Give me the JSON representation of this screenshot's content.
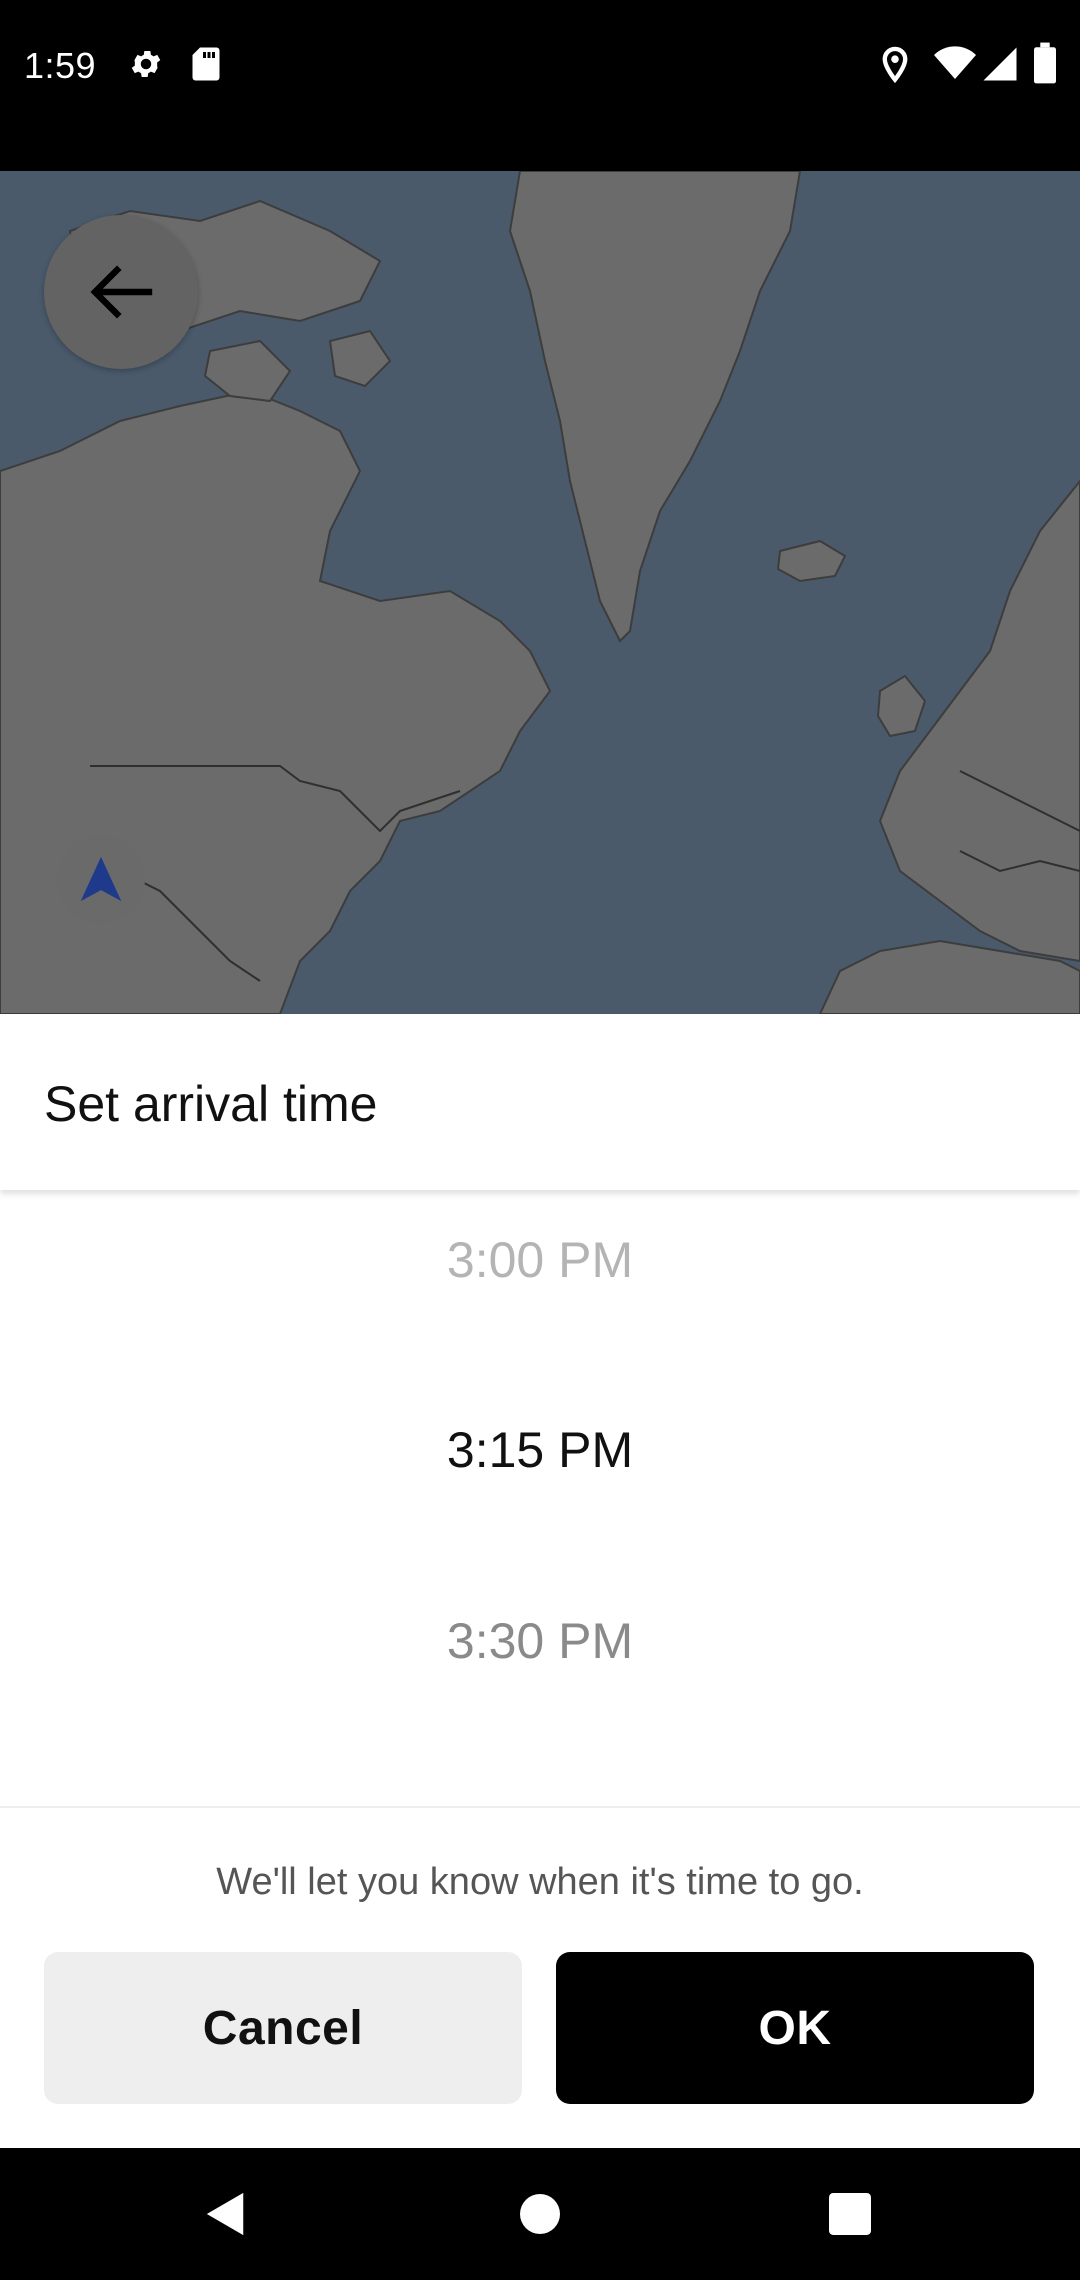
{
  "status_bar": {
    "time": "1:59",
    "icons": [
      "gear-icon",
      "sd-card-icon",
      "location-icon",
      "wifi-icon",
      "cellular-signal-icon",
      "battery-icon"
    ]
  },
  "map": {
    "back_icon": "arrow-left-icon",
    "location_icon": "navigation-arrow-icon"
  },
  "sheet": {
    "title": "Set arrival time"
  },
  "picker": {
    "items": [
      "3:00 PM",
      "3:15 PM",
      "3:30 PM"
    ],
    "selected": "3:15 PM"
  },
  "footer": {
    "note": "We'll let you know when it's time to go.",
    "cancel_label": "Cancel",
    "ok_label": "OK"
  },
  "nav_bar": {
    "icons": [
      "back-triangle-icon",
      "home-circle-icon",
      "recents-square-icon"
    ]
  },
  "colors": {
    "map_water": "#4a5a6b",
    "map_land": "#6b6b6b",
    "primary_button": "#000000",
    "secondary_button": "#eeeeee",
    "location_arrow": "#1f3a8a"
  }
}
